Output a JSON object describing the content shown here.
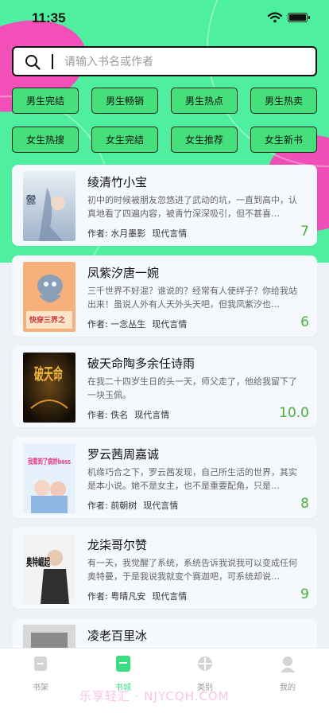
{
  "status_bar": {
    "time": "11:35"
  },
  "search": {
    "placeholder": "请输入书名或作者"
  },
  "categories": [
    "男生完结",
    "男生畅销",
    "男生热点",
    "男生热卖",
    "女生热搜",
    "女生完结",
    "女生推荐",
    "女生新书"
  ],
  "books": [
    {
      "title": "绫清竹小宝",
      "desc": "初中的时候被朋友忽悠进了武动的坑，一直到高中，认真地看了四遍内容，被青竹深深吸引，但不甚喜…",
      "author_prefix": "作者:",
      "author": "水月墨影",
      "genre": "现代言情",
      "score": "7",
      "cover_text": "有风的青竹之武"
    },
    {
      "title": "凤紫汐唐一婉",
      "desc": "三千世界不好混？谁说的？经常有人使绊子？你给我站出来！虽说人外有人天外头天吧，但我凤紫汐也…",
      "author_prefix": "作者:",
      "author": "一念丛生",
      "genre": "现代言情",
      "score": "6",
      "cover_text": "快穿三界之"
    },
    {
      "title": "破天命陶多余任诗雨",
      "desc": "在我二十四岁生日的头一天，师父走了，他给我留下了一块玉佩。",
      "author_prefix": "作者:",
      "author": "佚名",
      "genre": "现代言情",
      "score": "10.0",
      "cover_text": "破天命"
    },
    {
      "title": "罗云茜周嘉诚",
      "desc": "机缘巧合之下，罗云茜发现，自己所生活的世界，其实是本小说。她不是女主，也不是重要配角，只是…",
      "author_prefix": "作者:",
      "author": "前朝树",
      "genre": "现代言情",
      "score": "8",
      "cover_text": "我惹到了病娇boss"
    },
    {
      "title": "龙柒哥尔赞",
      "desc": "有一天，我觉醒了系统，系统告诉我说我可以变成任何奥特曼，于是我说我就变个赛迦吧，可系统却说…",
      "author_prefix": "作者:",
      "author": "粤晴凡安",
      "genre": "现代言情",
      "score": "9",
      "cover_text": "奥特崛起"
    },
    {
      "title": "凌老百里冰",
      "desc": "",
      "author_prefix": "",
      "author": "",
      "genre": "",
      "score": "",
      "cover_text": ""
    }
  ],
  "tabbar": [
    {
      "label": "书架",
      "icon": "bookshelf-icon",
      "active": false
    },
    {
      "label": "书城",
      "icon": "bookstore-icon",
      "active": true
    },
    {
      "label": "类别",
      "icon": "category-icon",
      "active": false
    },
    {
      "label": "我的",
      "icon": "profile-icon",
      "active": false
    }
  ],
  "watermark": "乐享轻汇 · NJYCQH.COM",
  "colors": {
    "accent_green": "#4ef0a0",
    "button_green": "#45e07c",
    "pink": "#f34fb8",
    "score_green": "#4caf3c"
  }
}
